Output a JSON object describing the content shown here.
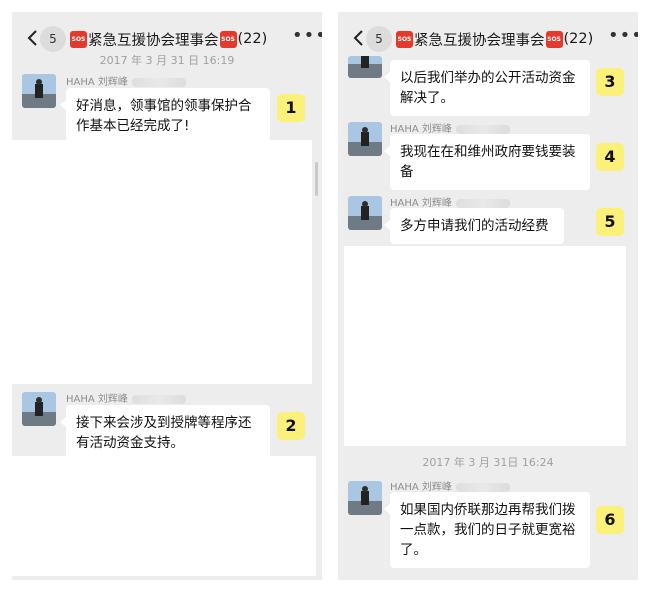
{
  "header": {
    "badge_count": "5",
    "title": "紧急互援协会理事会",
    "member_count": "(22)",
    "sos_label": "SOS",
    "back_icon": "chevron-left-icon",
    "more_icon": "more-dots-icon"
  },
  "timestamps": {
    "left_top": "2017 年 3 月 31 日 16:19",
    "right_mid": "2017 年 3 月 31日 16:24"
  },
  "sender": "HAHA 刘辉峰",
  "messages": {
    "m1": "好消息，领事馆的领事保护合作基本已经完成了!",
    "m2": "接下来会涉及到授牌等程序还有活动资金支持。",
    "m3": "以后我们举办的公开活动资金解决了。",
    "m4": "我现在在和维州政府要钱要装备",
    "m5": "多方申请我们的活动经费",
    "m6": "如果国内侨联那边再帮我们拨一点款，我们的日子就更宽裕了。"
  },
  "markers": [
    "1",
    "2",
    "3",
    "4",
    "5",
    "6"
  ],
  "colors": {
    "panel_bg": "#ededed",
    "bubble_bg": "#ffffff",
    "marker_bg": "#fbf07a",
    "sos_red": "#e23b2e"
  }
}
